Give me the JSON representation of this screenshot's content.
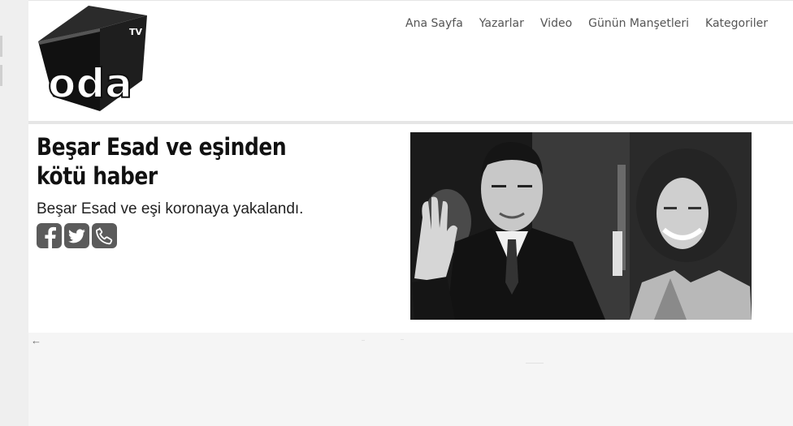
{
  "nav": {
    "items": [
      "Ana Sayfa",
      "Yazarlar",
      "Video",
      "Günün Manşetleri",
      "Kategoriler"
    ]
  },
  "logo": {
    "text": "oda",
    "superscript": "TV",
    "icon": "odatv-cube-logo"
  },
  "article": {
    "title": "Beşar Esad ve eşinden kötü haber",
    "summary": "Beşar Esad ve eşi koronaya yakalandı.",
    "share": [
      "facebook-icon",
      "twitter-icon",
      "phone-icon"
    ],
    "image": "bashar-and-asma-assad-photo"
  },
  "back_arrow": "←",
  "colors": {
    "header_bg": "#ffffff",
    "icon_bg": "#5b5b5b",
    "page_bg": "#f2f2f2"
  }
}
